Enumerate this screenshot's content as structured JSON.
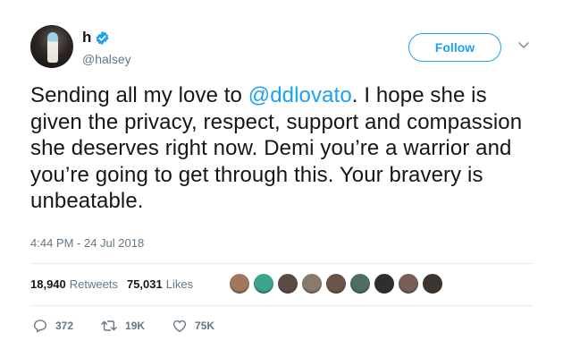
{
  "author": {
    "display_name": "h",
    "handle": "@halsey",
    "verified": true
  },
  "follow_button": {
    "label": "Follow"
  },
  "tweet": {
    "text_before": "Sending all my love to ",
    "mention": "@ddlovato",
    "text_after": ". I hope she is given the privacy, respect, support and compassion she deserves right now. Demi you’re a warrior and you’re going to get through this. Your bravery is unbeatable.",
    "timestamp": "4:44 PM - 24 Jul 2018"
  },
  "stats": {
    "retweets_count": "18,940",
    "retweets_label": "Retweets",
    "likes_count": "75,031",
    "likes_label": "Likes"
  },
  "liker_avatar_colors": [
    "#a0785e",
    "#3aa58a",
    "#5b4b43",
    "#8a7a6c",
    "#6b5548",
    "#4f6e63",
    "#2e2e2e",
    "#7a5e58",
    "#3c3530"
  ],
  "actions": {
    "replies": "372",
    "retweets": "19K",
    "likes": "75K"
  },
  "colors": {
    "accent": "#1da1f2",
    "text": "#14171a",
    "secondary": "#657786",
    "divider": "#e6ecf0"
  }
}
